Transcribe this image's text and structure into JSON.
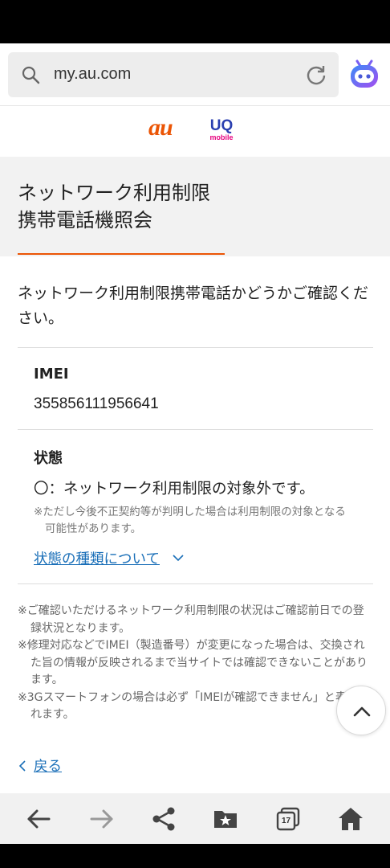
{
  "browser": {
    "url": "my.au.com",
    "icons": [
      "search-icon",
      "reload-icon",
      "assistant-icon"
    ]
  },
  "brand": {
    "au_logo": "au",
    "uq_logo_top": "UQ",
    "uq_logo_bottom": "mobile",
    "colors": {
      "au": "#eb5505",
      "uq_blue": "#2a3fb0",
      "uq_pink": "#e6007e"
    }
  },
  "page": {
    "title_line1": "ネットワーク利用制限",
    "title_line2": "携帯電話機照会",
    "intro": "ネットワーク利用制限携帯電話かどうかご確認ください。",
    "accent_color": "#eb5505"
  },
  "result": {
    "imei_label": "IMEI",
    "imei_value": "355856111956641",
    "status_label": "状態",
    "status_value": "〇：ネットワーク利用制限の対象外です。",
    "status_note": "※ただし今後不正契約等が判明した場合は利用制限の対象となる可能性があります。",
    "status_link": "状態の種類について"
  },
  "notes": [
    "※ご確認いただけるネットワーク利用制限の状況はご確認前日での登録状況となります。",
    "※修理対応などでIMEI（製造番号）が変更になった場合は、交換された旨の情報が反映されるまで当サイトでは確認できないことがあります。",
    "※3Gスマートフォンの場合は必ず「IMEIが確認できません」と表記されます。"
  ],
  "back_link": "戻る",
  "nav": {
    "tabs_count": "17",
    "items": [
      "back-arrow-icon",
      "forward-arrow-icon",
      "share-icon",
      "bookmarks-icon",
      "tabs-icon",
      "home-icon"
    ]
  }
}
